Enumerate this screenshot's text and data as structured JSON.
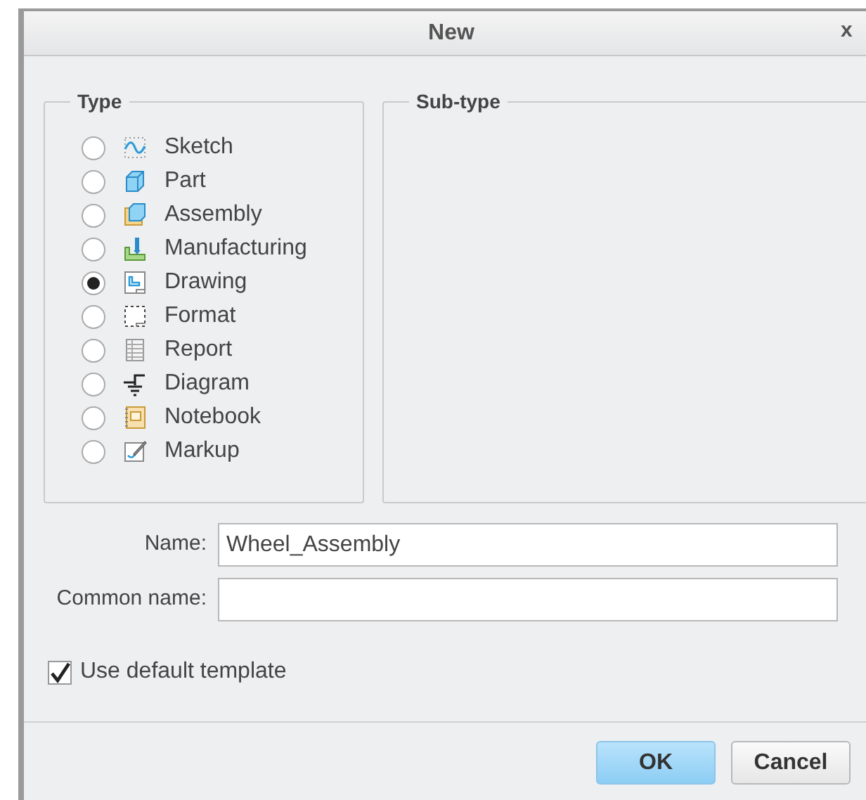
{
  "window": {
    "title": "New",
    "close": "x"
  },
  "type_group": {
    "title": "Type",
    "options": [
      {
        "kind": "sketch",
        "label": "Sketch",
        "selected": false
      },
      {
        "kind": "part",
        "label": "Part",
        "selected": false
      },
      {
        "kind": "assembly",
        "label": "Assembly",
        "selected": false
      },
      {
        "kind": "manufacturing",
        "label": "Manufacturing",
        "selected": false
      },
      {
        "kind": "drawing",
        "label": "Drawing",
        "selected": true
      },
      {
        "kind": "format",
        "label": "Format",
        "selected": false
      },
      {
        "kind": "report",
        "label": "Report",
        "selected": false
      },
      {
        "kind": "diagram",
        "label": "Diagram",
        "selected": false
      },
      {
        "kind": "notebook",
        "label": "Notebook",
        "selected": false
      },
      {
        "kind": "markup",
        "label": "Markup",
        "selected": false
      }
    ]
  },
  "subtype_group": {
    "title": "Sub-type"
  },
  "fields": [
    {
      "label": "Name:",
      "value": "Wheel_Assembly"
    },
    {
      "label": "Common name:"
    }
  ],
  "use_default_template": {
    "label": "Use default template",
    "checked": true
  },
  "buttons": [
    {
      "label": "OK",
      "primary": true
    },
    {
      "label": "Cancel",
      "primary": false
    }
  ]
}
